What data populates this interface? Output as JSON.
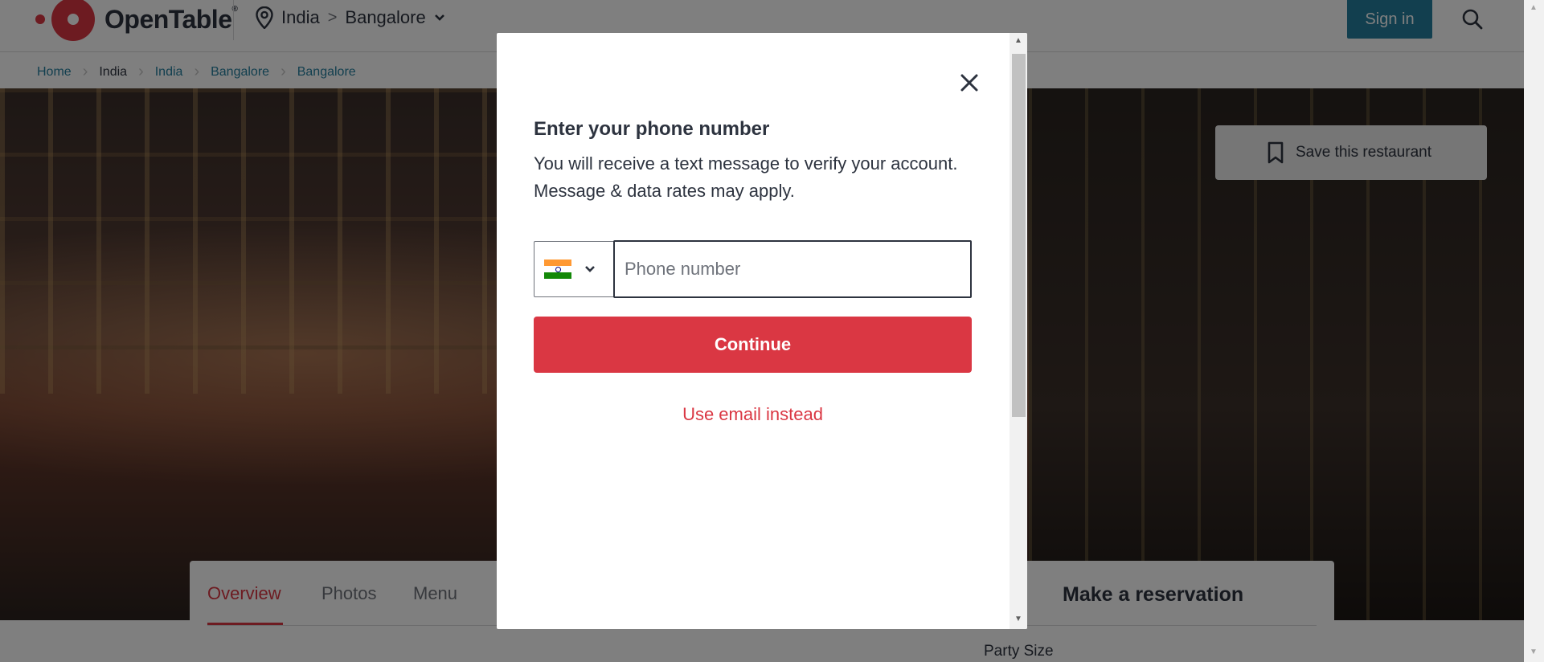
{
  "header": {
    "logo_text": "OpenTable",
    "logo_reg": "®",
    "location_country": "India",
    "location_sep": ">",
    "location_city": "Bangalore",
    "sign_in_label": "Sign in"
  },
  "breadcrumb": [
    "Home",
    "India",
    "India",
    "Bangalore",
    "Bangalore"
  ],
  "hero": {
    "save_label": "Save this restaurant"
  },
  "tabs": [
    "Overview",
    "Photos",
    "Menu"
  ],
  "active_tab": "Overview",
  "reservation": {
    "title": "Make a reservation",
    "party_size_label": "Party Size"
  },
  "modal": {
    "title": "Enter your phone number",
    "description_line1": "You will receive a text message to verify your account.",
    "description_line2": "Message & data rates may apply.",
    "country_flag": "India",
    "phone_placeholder": "Phone number",
    "phone_value": "",
    "continue_label": "Continue",
    "alt_link": "Use email instead"
  },
  "colors": {
    "brand_red": "#da3743",
    "sign_in_teal": "#247f9e",
    "text_dark": "#2d333f"
  },
  "icons": [
    "location-pin-icon",
    "chevron-down-icon",
    "search-icon",
    "bookmark-icon",
    "close-icon",
    "india-flag-icon"
  ]
}
